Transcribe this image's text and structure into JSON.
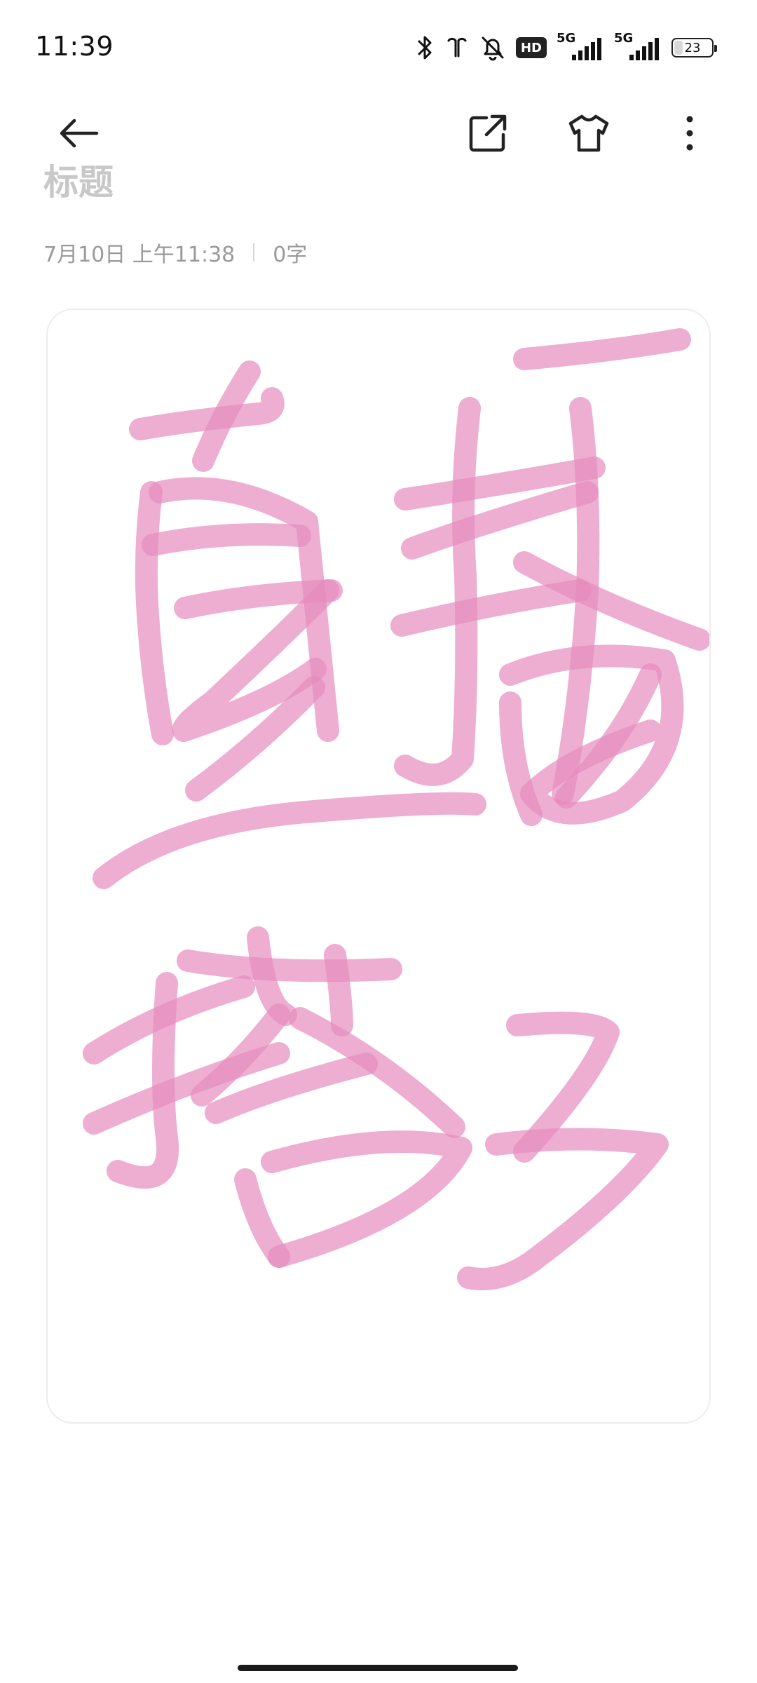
{
  "status_bar": {
    "time": "11:39",
    "hd_label": "HD",
    "sim1_label": "5G",
    "sim2_label": "5G",
    "battery_level": 23,
    "battery_text": "23",
    "icons": [
      "bluetooth-icon",
      "earbuds-icon",
      "mute-icon",
      "hd-voice-icon",
      "signal-icon",
      "signal-icon",
      "battery-icon"
    ]
  },
  "toolbar": {
    "icons": [
      "back-arrow-icon",
      "share-icon",
      "shirt-icon",
      "more-vertical-icon"
    ]
  },
  "note": {
    "title": "标题",
    "date": "7月10日 上午11:38",
    "char_count": "0字"
  },
  "drawing": {
    "ink_color": "#e68bbe",
    "content": "handwritten-sketch"
  },
  "colors": {
    "background": "#ffffff",
    "meta_text": "#9a9a9a",
    "title_placeholder": "#c8c8c8",
    "ink": "#e68bbe"
  }
}
